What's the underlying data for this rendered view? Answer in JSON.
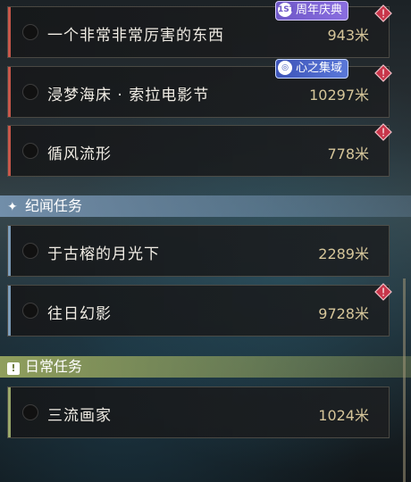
{
  "tasks_main": [
    {
      "title": "一个非常非常厉害的东西",
      "distance": "943米",
      "tag": "1ST周年庆典",
      "tag_icon": "1ST",
      "tag_text": "周年庆典"
    },
    {
      "title": "浸梦海床 · 索拉电影节",
      "distance": "10297米",
      "tag": "心之集域",
      "tag_icon": "◎",
      "tag_text": "心之集域"
    },
    {
      "title": "循风流形",
      "distance": "778米"
    }
  ],
  "section_story": {
    "label": "纪闻任务",
    "icon": "✦"
  },
  "tasks_story": [
    {
      "title": "于古榕的月光下",
      "distance": "2289米"
    },
    {
      "title": "往日幻影",
      "distance": "9728米"
    }
  ],
  "section_daily": {
    "label": "日常任务",
    "icon": "!"
  },
  "tasks_daily": [
    {
      "title": "三流画家",
      "distance": "1024米"
    }
  ],
  "colors": {
    "main_bar": "#c8574a",
    "story_bar": "#7c9cb8",
    "daily_bar": "#9aa86a",
    "distance": "#d6c69a",
    "alert": "#c8364a"
  }
}
